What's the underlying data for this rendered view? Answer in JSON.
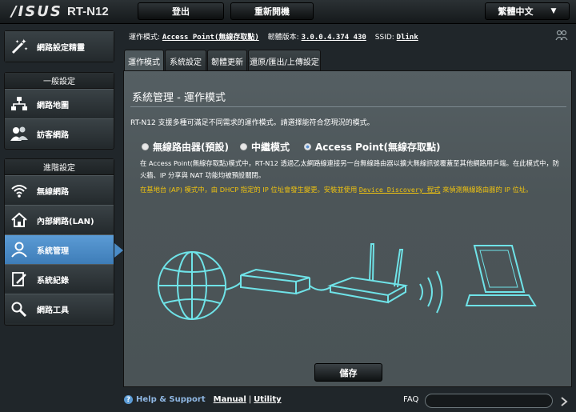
{
  "header": {
    "logo": "/ISUS",
    "model": "RT-N12",
    "logout_label": "登出",
    "reboot_label": "重新開機",
    "language": "繁體中文"
  },
  "sidebar": {
    "quick_setup": "網路設定精靈",
    "general_title": "一般設定",
    "general_items": [
      {
        "label": "網路地圖",
        "icon": "network-map-icon"
      },
      {
        "label": "訪客網路",
        "icon": "guest-network-icon"
      }
    ],
    "advanced_title": "進階設定",
    "advanced_items": [
      {
        "label": "無線網路",
        "icon": "wireless-icon"
      },
      {
        "label": "內部網路(LAN)",
        "icon": "home-lan-icon"
      },
      {
        "label": "系統管理",
        "icon": "admin-icon",
        "active": true
      },
      {
        "label": "系統紀錄",
        "icon": "system-log-icon"
      },
      {
        "label": "網路工具",
        "icon": "network-tools-icon"
      }
    ]
  },
  "info_bar": {
    "mode_label": "運作模式:",
    "mode_value": "Access Point(無線存取點)",
    "firmware_label": "韌體版本:",
    "firmware_value": "3.0.0.4.374_430",
    "ssid_label": "SSID:",
    "ssid_value": "Dlink"
  },
  "tabs": [
    "運作模式",
    "系統設定",
    "韌體更新",
    "還原/匯出/上傳設定"
  ],
  "main": {
    "title": "系統管理 - 運作模式",
    "description": "RT-N12 支援多種可滿足不同需求的運作模式。請選擇能符合您現況的模式。",
    "modes": [
      {
        "label": "無線路由器(預設)",
        "selected": false
      },
      {
        "label": "中繼模式",
        "selected": false
      },
      {
        "label": "Access Point(無線存取點)",
        "selected": true
      }
    ],
    "paragraph": "在 Access Point(無線存取點)模式中，RT-N12 透過乙太網路線連接另一台無線路由器以擴大無線訊號覆蓋至其他網路用戶端。在此模式中，防火牆、IP 分享與 NAT 功能均被預設關閉。",
    "note_before": "在基地台 (AP) 模式中，由 DHCP 指定的 IP 位址會發生變更。安裝並使用",
    "note_link": "Device Discovery 程式",
    "note_after": "來偵測無線路由器的 IP 位址。",
    "save_label": "儲存"
  },
  "footer": {
    "help": "Help & Support",
    "manual": "Manual",
    "separator": "|",
    "utility": "Utility",
    "faq": "FAQ"
  },
  "colors": {
    "accent": "#5b9bd5",
    "note": "#f1c40f",
    "diagram": "#6fe3e8"
  }
}
